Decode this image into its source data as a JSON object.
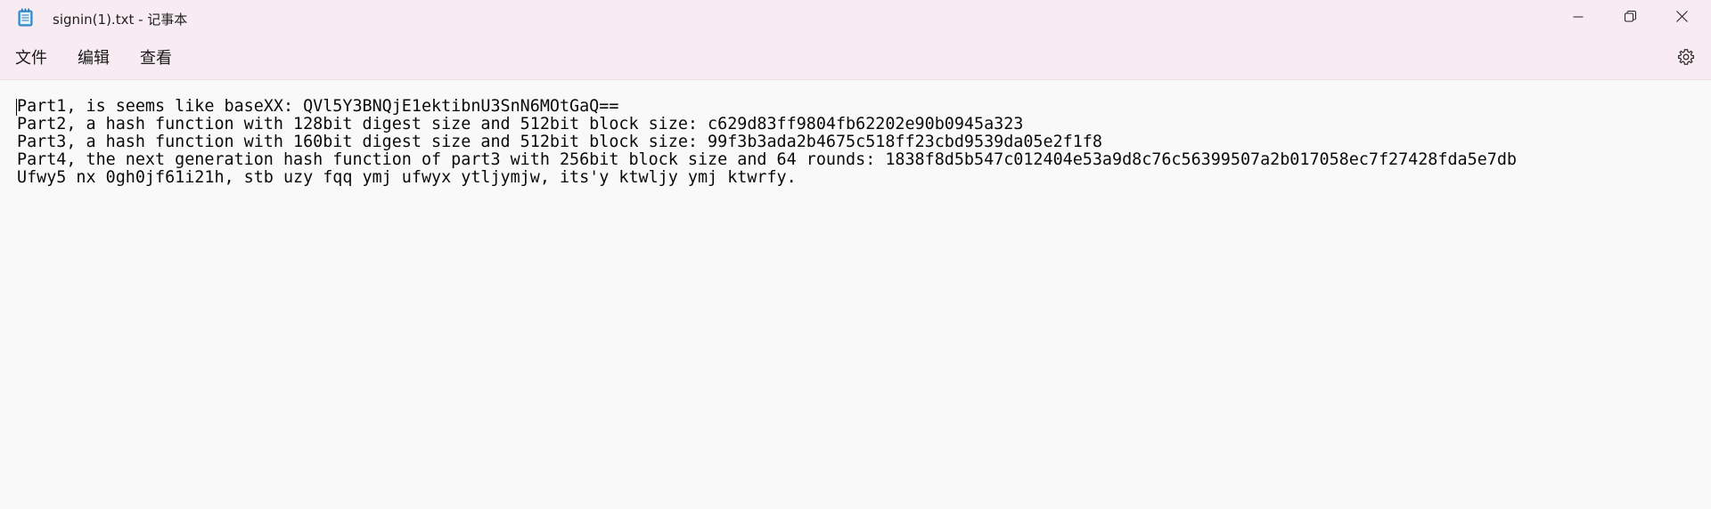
{
  "window": {
    "title": "signin(1).txt - 记事本",
    "app_icon": "notepad-icon",
    "controls": {
      "minimize_icon": "minimize-icon",
      "maximize_icon": "restore-icon",
      "close_icon": "close-icon"
    }
  },
  "menubar": {
    "items": [
      {
        "label": "文件"
      },
      {
        "label": "编辑"
      },
      {
        "label": "查看"
      }
    ],
    "settings_icon": "gear-icon"
  },
  "editor": {
    "lines": [
      "Part1, is seems like baseXX: QVl5Y3BNQjE1ektibnU3SnN6MOtGaQ==",
      "Part2, a hash function with 128bit digest size and 512bit block size: c629d83ff9804fb62202e90b0945a323",
      "Part3, a hash function with 160bit digest size and 512bit block size: 99f3b3ada2b4675c518ff23cbd9539da05e2f1f8",
      "Part4, the next generation hash function of part3 with 256bit block size and 64 rounds: 1838f8d5b547c012404e53a9d8c76c56399507a2b017058ec7f27428fda5e7db",
      "Ufwy5 nx 0gh0jf61i21h, stb uzy fqq ymj ufwyx ytljymjw, its'y ktwljy ymj ktwrfy."
    ]
  },
  "colors": {
    "titlebar_bg": "#f8ebf2",
    "editor_bg": "#f9f9f9",
    "text": "#0a0a0a"
  }
}
